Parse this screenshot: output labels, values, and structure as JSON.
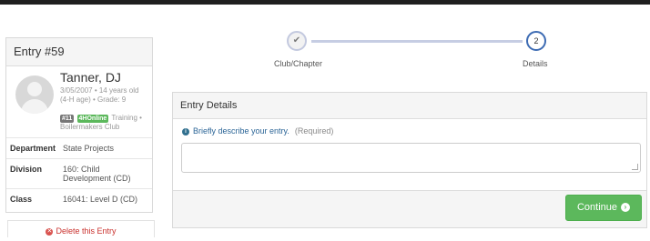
{
  "entry": {
    "title": "Entry #59",
    "member": {
      "name": "Tanner, DJ",
      "meta_line1": "3/05/2007 • 14 years old",
      "meta_line2": "(4-H age) • Grade: 9",
      "badge_id": "#11",
      "badge_online": "4HOnline",
      "training_label": "Training •",
      "club": "Boilermakers Club"
    },
    "details": [
      {
        "key": "Department",
        "value": "State Projects"
      },
      {
        "key": "Division",
        "value": "160: Child Development (CD)"
      },
      {
        "key": "Class",
        "value": "16041: Level D (CD)"
      }
    ],
    "delete_label": "Delete this Entry"
  },
  "stepper": {
    "steps": [
      {
        "icon": "checkmark-icon",
        "marker": "✔",
        "label": "Club/Chapter",
        "state": "complete"
      },
      {
        "marker": "2",
        "label": "Details",
        "state": "active"
      }
    ]
  },
  "panel": {
    "title": "Entry Details",
    "field_prompt": "Briefly describe your entry.",
    "field_required": "(Required)",
    "field_value": "",
    "continue_label": "Continue"
  },
  "colors": {
    "primary_green": "#5cb85c",
    "danger_red": "#d9534f",
    "step_active": "#3d6bb3",
    "link_blue": "#2a6496"
  }
}
